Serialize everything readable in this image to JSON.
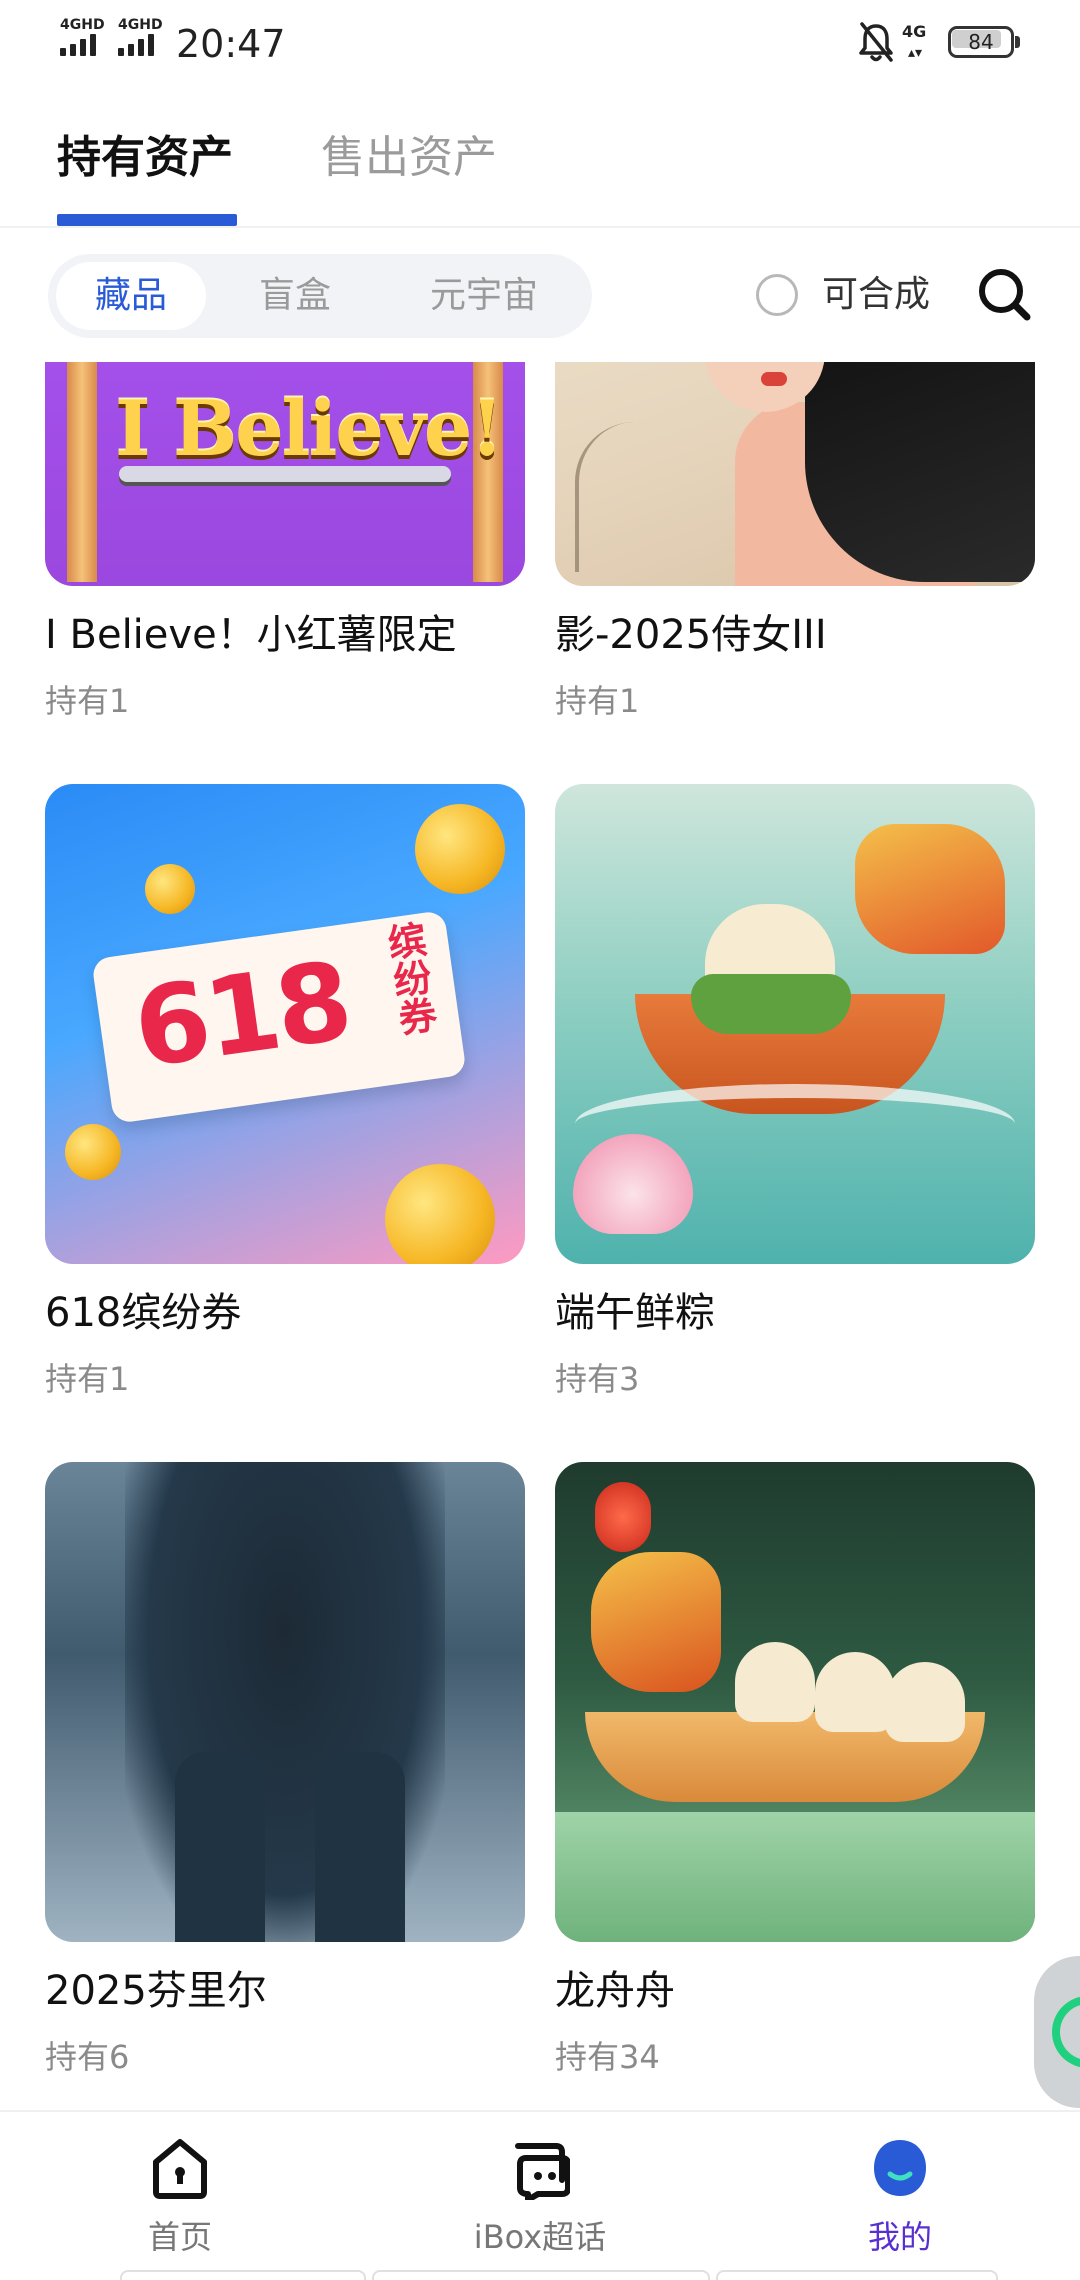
{
  "status_bar": {
    "signal_1": "4GHD",
    "signal_2": "4GHD",
    "time": "20:47",
    "network_right": "4G",
    "battery": "84",
    "battery_level": 0.84
  },
  "top_tabs": [
    {
      "label": "持有资产",
      "active": true
    },
    {
      "label": "售出资产",
      "active": false
    }
  ],
  "filter": {
    "segments": [
      {
        "label": "藏品",
        "active": true
      },
      {
        "label": "盲盒",
        "active": false
      },
      {
        "label": "元宇宙",
        "active": false
      }
    ],
    "merge_label": "可合成",
    "merge_checked": false
  },
  "cards": [
    {
      "title": "I Believe！小红薯限定",
      "hold": "持有1",
      "art_text": "I Believe!"
    },
    {
      "title": "影-2025侍女III",
      "hold": "持有1"
    },
    {
      "title": "618缤纷券",
      "hold": "持有1",
      "art_text": "618",
      "art_side": "缤纷券"
    },
    {
      "title": "端午鲜粽",
      "hold": "持有3"
    },
    {
      "title": "2025芬里尔",
      "hold": "持有6"
    },
    {
      "title": "龙舟舟",
      "hold": "持有34"
    }
  ],
  "bottom_nav": [
    {
      "label": "首页",
      "icon": "home-icon",
      "active": false
    },
    {
      "label": "iBox超话",
      "icon": "chat-icon",
      "active": false
    },
    {
      "label": "我的",
      "icon": "profile-icon",
      "active": true
    }
  ],
  "colors": {
    "accent_blue": "#2a5bd7",
    "active_purple": "#5a2fd0",
    "float_green": "#1fd07e"
  }
}
